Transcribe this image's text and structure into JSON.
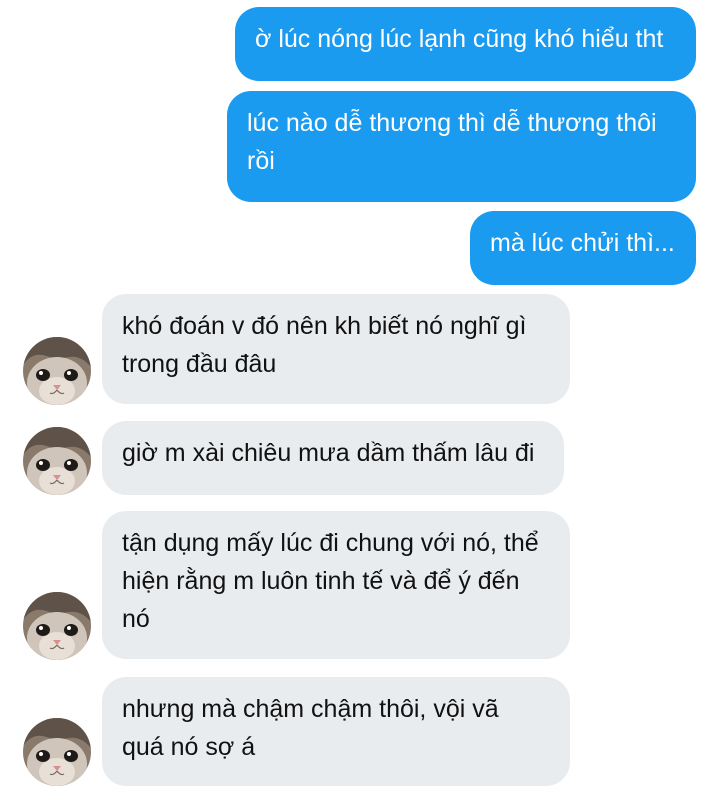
{
  "conversation": {
    "sent": [
      {
        "text": "ờ lúc nóng lúc lạnh cũng khó hiểu tht"
      },
      {
        "text": "lúc nào dễ thương thì dễ thương thôi\nrồi"
      },
      {
        "text": "mà lúc chửi thì..."
      }
    ],
    "received": [
      {
        "text": "khó đoán v đó nên kh biết nó nghĩ gì\ntrong đầu đâu",
        "avatar": "cat-avatar-icon"
      },
      {
        "text": "giờ m xài chiêu mưa dầm thấm lâu đi",
        "avatar": "cat-avatar-icon"
      },
      {
        "text": "tận dụng mấy lúc đi chung với nó, thể\nhiện rằng m luôn tinh tế và để ý đến\nnó",
        "avatar": "cat-avatar-icon"
      },
      {
        "text": "nhưng mà chậm chậm thôi, vội vã\nquá nó sợ á",
        "avatar": "cat-avatar-icon"
      }
    ]
  },
  "colors": {
    "sent_bubble": "#1a9bf0",
    "received_bubble": "#e9ecef",
    "background": "#ffffff"
  }
}
